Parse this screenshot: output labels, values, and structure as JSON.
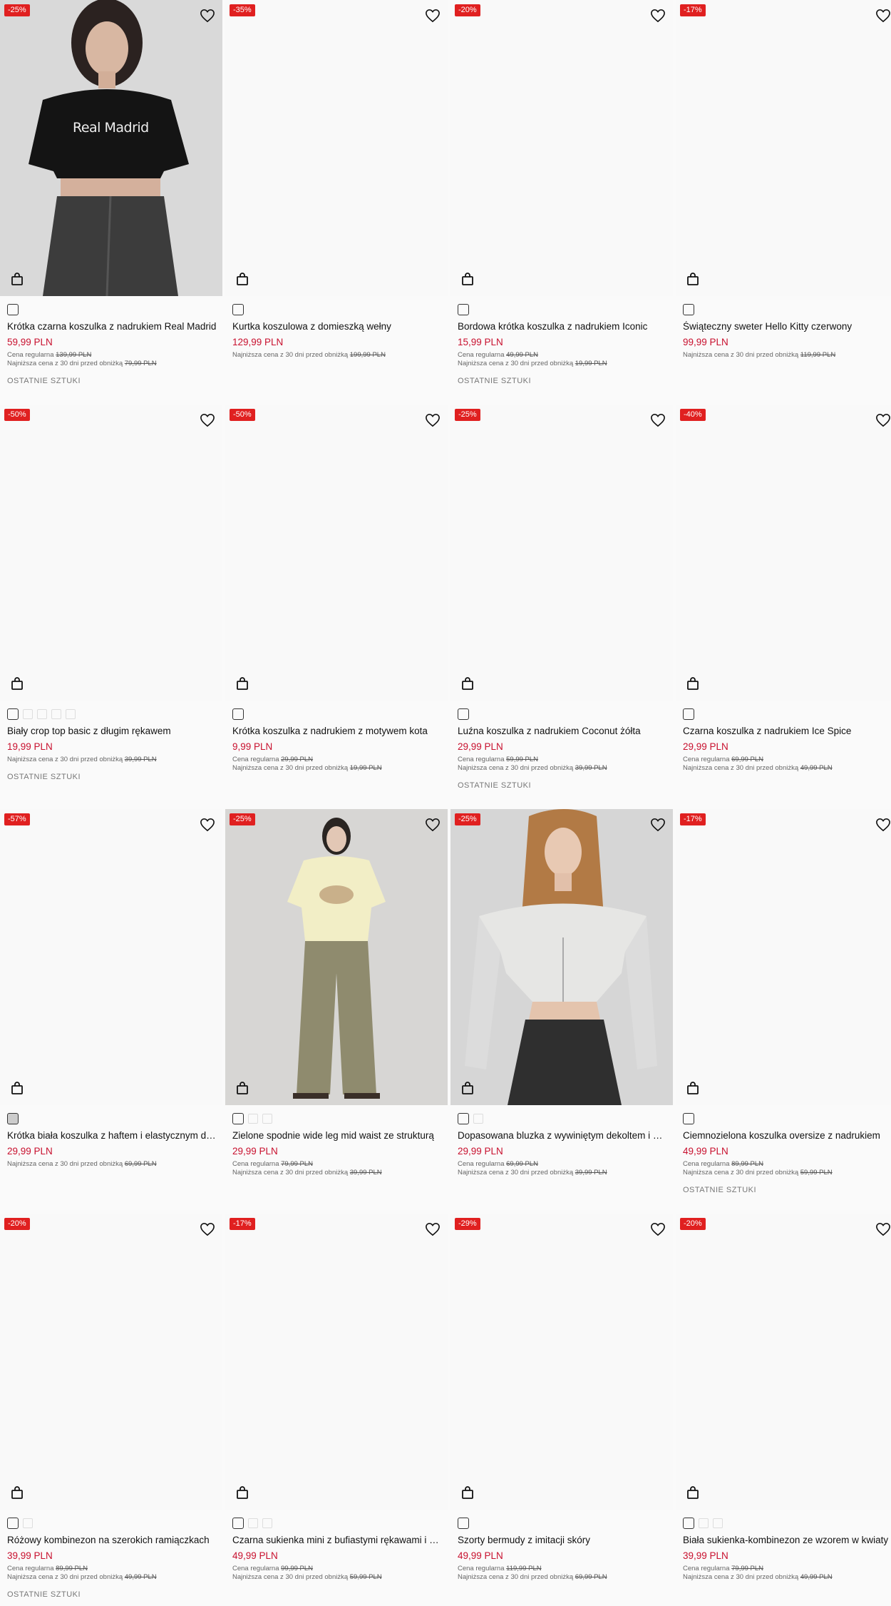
{
  "colors": {
    "price": "#c8102e",
    "badge": "#e02020"
  },
  "labels": {
    "regular": "Cena regularna",
    "lowest": "Najniższa cena z 30 dni przed obniżką",
    "last_items": "OSTATNIE SZTUKI"
  },
  "products": [
    {
      "discount": "-25%",
      "title": "Krótka czarna koszulka z nadrukiem Real Madrid",
      "price": "59,99 PLN",
      "regular": "139,99 PLN",
      "lowest": "79,99 PLN",
      "last": true,
      "extra_swatches": 0
    },
    {
      "discount": "-35%",
      "title": "Kurtka koszulowa z domieszką wełny",
      "price": "129,99 PLN",
      "regular": "",
      "lowest": "199,99 PLN",
      "last": false,
      "extra_swatches": 0
    },
    {
      "discount": "-20%",
      "title": "Bordowa krótka koszulka z nadrukiem Iconic",
      "price": "15,99 PLN",
      "regular": "49,99 PLN",
      "lowest": "19,99 PLN",
      "last": true,
      "extra_swatches": 0
    },
    {
      "discount": "-17%",
      "title": "Świąteczny sweter Hello Kitty czerwony",
      "price": "99,99 PLN",
      "regular": "",
      "lowest": "119,99 PLN",
      "last": false,
      "extra_swatches": 0
    },
    {
      "discount": "-50%",
      "title": "Biały crop top basic z długim rękawem",
      "price": "19,99 PLN",
      "regular": "",
      "lowest": "39,99 PLN",
      "last": true,
      "extra_swatches": 4
    },
    {
      "discount": "-50%",
      "title": "Krótka koszulka z nadrukiem z motywem kota",
      "price": "9,99 PLN",
      "regular": "29,99 PLN",
      "lowest": "19,99 PLN",
      "last": false,
      "extra_swatches": 0
    },
    {
      "discount": "-25%",
      "title": "Luźna koszulka z nadrukiem Coconut żółta",
      "price": "29,99 PLN",
      "regular": "59,99 PLN",
      "lowest": "39,99 PLN",
      "last": true,
      "extra_swatches": 0
    },
    {
      "discount": "-40%",
      "title": "Czarna koszulka z nadrukiem Ice Spice",
      "price": "29,99 PLN",
      "regular": "69,99 PLN",
      "lowest": "49,99 PLN",
      "last": false,
      "extra_swatches": 0
    },
    {
      "discount": "-57%",
      "title": "Krótka biała koszulka z haftem i elastycznym dołem",
      "price": "29,99 PLN",
      "regular": "",
      "lowest": "69,99 PLN",
      "last": false,
      "extra_swatches": 0
    },
    {
      "discount": "-25%",
      "title": "Zielone spodnie wide leg mid waist ze strukturą",
      "price": "29,99 PLN",
      "regular": "79,99 PLN",
      "lowest": "39,99 PLN",
      "last": false,
      "extra_swatches": 2
    },
    {
      "discount": "-25%",
      "title": "Dopasowana bluzka z wywiniętym dekoltem i wiązaniem",
      "price": "29,99 PLN",
      "regular": "69,99 PLN",
      "lowest": "39,99 PLN",
      "last": false,
      "extra_swatches": 1
    },
    {
      "discount": "-17%",
      "title": "Ciemnozielona koszulka oversize z nadrukiem",
      "price": "49,99 PLN",
      "regular": "89,99 PLN",
      "lowest": "59,99 PLN",
      "last": true,
      "extra_swatches": 0
    },
    {
      "discount": "-20%",
      "title": "Różowy kombinezon na szerokich ramiączkach",
      "price": "39,99 PLN",
      "regular": "89,99 PLN",
      "lowest": "49,99 PLN",
      "last": true,
      "extra_swatches": 1
    },
    {
      "discount": "-17%",
      "title": "Czarna sukienka mini z bufiastymi rękawami i kokardą",
      "price": "49,99 PLN",
      "regular": "99,99 PLN",
      "lowest": "59,99 PLN",
      "last": false,
      "extra_swatches": 2
    },
    {
      "discount": "-29%",
      "title": "Szorty bermudy z imitacji skóry",
      "price": "49,99 PLN",
      "regular": "119,99 PLN",
      "lowest": "69,99 PLN",
      "last": false,
      "extra_swatches": 0
    },
    {
      "discount": "-20%",
      "title": "Biała sukienka-kombinezon ze wzorem w kwiaty",
      "price": "39,99 PLN",
      "regular": "79,99 PLN",
      "lowest": "49,99 PLN",
      "last": false,
      "extra_swatches": 2
    }
  ],
  "photo_texts": {
    "shirt_print": "Real Madrid"
  }
}
